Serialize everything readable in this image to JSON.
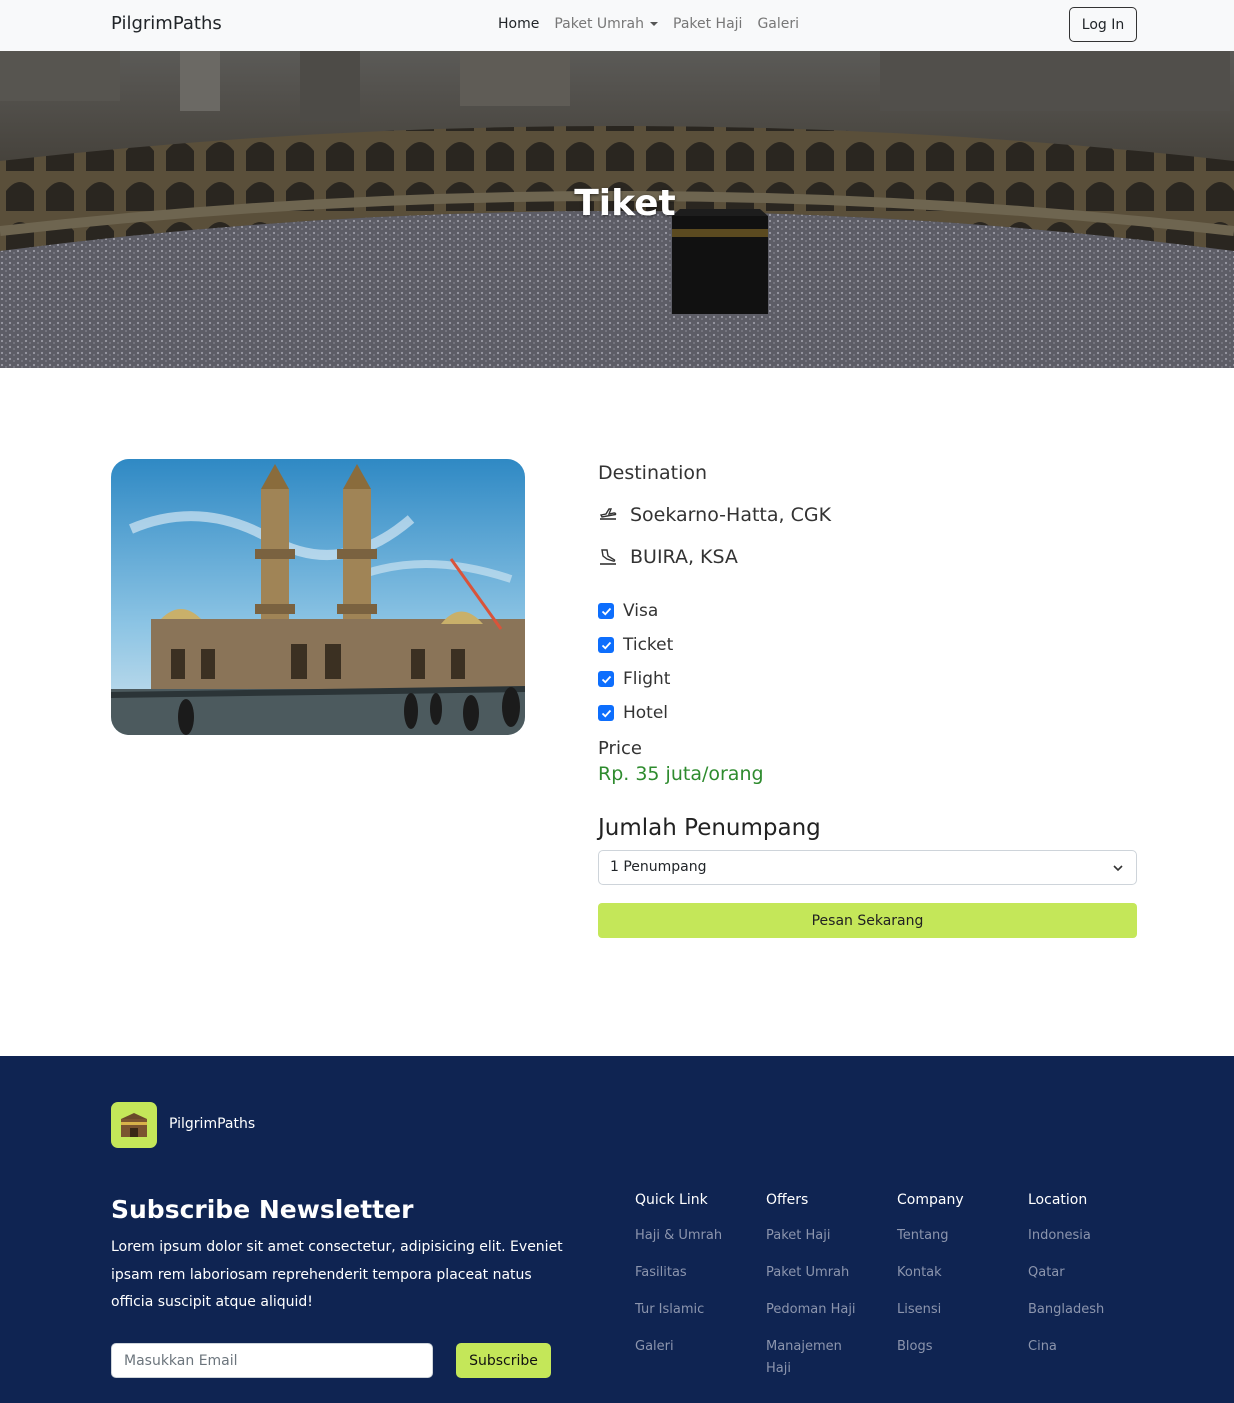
{
  "nav": {
    "brand": "PilgrimPaths",
    "links": [
      {
        "label": "Home",
        "active": true
      },
      {
        "label": "Paket Umrah",
        "dropdown": true
      },
      {
        "label": "Paket Haji"
      },
      {
        "label": "Galeri"
      }
    ],
    "login_label": "Log In"
  },
  "hero": {
    "title": "Tiket"
  },
  "ticket": {
    "destination_label": "Destination",
    "origin": "Soekarno-Hatta, CGK",
    "destination": "BUIRA, KSA",
    "inclusions": [
      {
        "label": "Visa",
        "checked": true
      },
      {
        "label": "Ticket",
        "checked": true
      },
      {
        "label": "Flight",
        "checked": true
      },
      {
        "label": "Hotel",
        "checked": true
      }
    ],
    "price_label": "Price",
    "price_value": "Rp. 35 juta/orang",
    "passenger_heading": "Jumlah Penumpang",
    "passenger_selected": "1 Penumpang",
    "order_label": "Pesan Sekarang"
  },
  "footer": {
    "brand": "PilgrimPaths",
    "subscribe_title": "Subscribe Newsletter",
    "subscribe_desc": "Lorem ipsum dolor sit amet consectetur, adipisicing elit. Eveniet ipsam rem laboriosam reprehenderit tempora placeat natus officia suscipit atque aliquid!",
    "email_placeholder": "Masukkan Email",
    "subscribe_label": "Subscribe",
    "columns": [
      {
        "title": "Quick Link",
        "links": [
          "Haji & Umrah",
          "Fasilitas",
          "Tur Islamic",
          "Galeri"
        ]
      },
      {
        "title": "Offers",
        "links": [
          "Paket Haji",
          "Paket Umrah",
          "Pedoman Haji",
          "Manajemen Haji"
        ]
      },
      {
        "title": "Company",
        "links": [
          "Tentang",
          "Kontak",
          "Lisensi",
          "Blogs"
        ]
      },
      {
        "title": "Location",
        "links": [
          "Indonesia",
          "Qatar",
          "Bangladesh",
          "Cina"
        ]
      }
    ]
  },
  "colors": {
    "accent": "#c4e759",
    "footer_bg": "#0f2452",
    "price": "#2e8b2e",
    "checkbox": "#0d6efd"
  },
  "icons": [
    "takeoff-icon",
    "landing-icon",
    "check-icon",
    "chevron-down-icon",
    "kaaba-icon"
  ]
}
